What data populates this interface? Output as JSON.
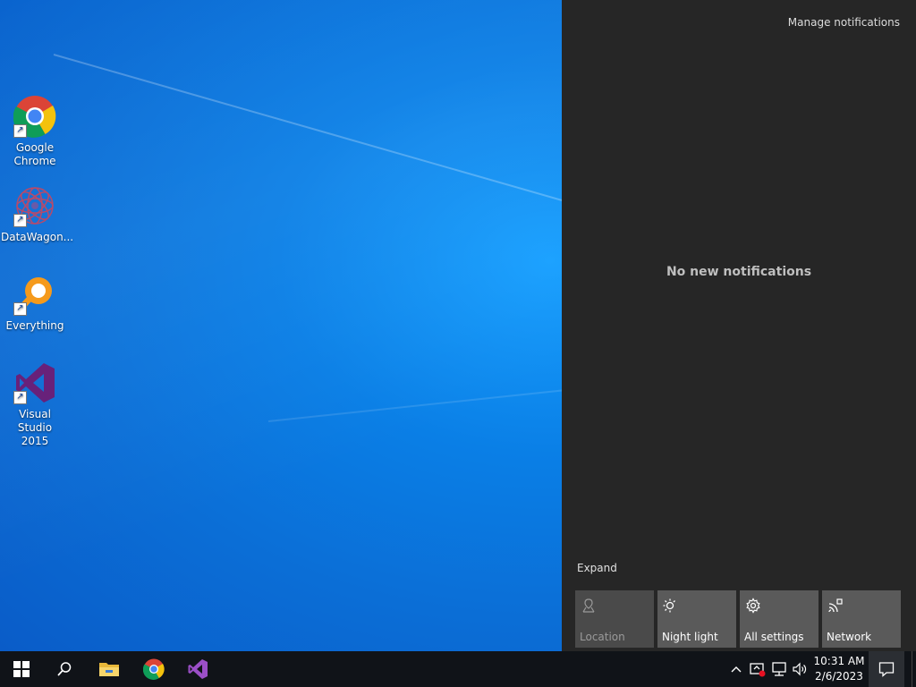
{
  "desktop": {
    "icons": [
      {
        "label": "Google\nChrome",
        "line1": "Google",
        "line2": "Chrome"
      },
      {
        "line1": "DataWagon...",
        "line2": ""
      },
      {
        "line1": "Everything",
        "line2": ""
      },
      {
        "line1": "Visual Studio",
        "line2": "2015"
      }
    ]
  },
  "action_center": {
    "manage_label": "Manage notifications",
    "empty_message": "No new notifications",
    "expand_label": "Expand",
    "tiles": [
      {
        "label": "Location",
        "icon": "location-icon",
        "enabled": false
      },
      {
        "label": "Night light",
        "icon": "night-light-icon",
        "enabled": true
      },
      {
        "label": "All settings",
        "icon": "gear-icon",
        "enabled": true
      },
      {
        "label": "Network",
        "icon": "network-icon",
        "enabled": true
      }
    ]
  },
  "taskbar": {
    "pinned": [
      "start-icon",
      "search-icon",
      "file-explorer-icon",
      "chrome-icon",
      "visual-studio-icon"
    ],
    "tray": [
      "chevron-up-icon",
      "security-icon",
      "network-icon",
      "volume-icon"
    ],
    "time": "10:31 AM",
    "date": "2/6/2023"
  },
  "colors": {
    "accent": "#0a7fe6",
    "action_center_bg": "#262626",
    "tile_bg": "#5a5a5a",
    "taskbar_bg": "#101318"
  }
}
